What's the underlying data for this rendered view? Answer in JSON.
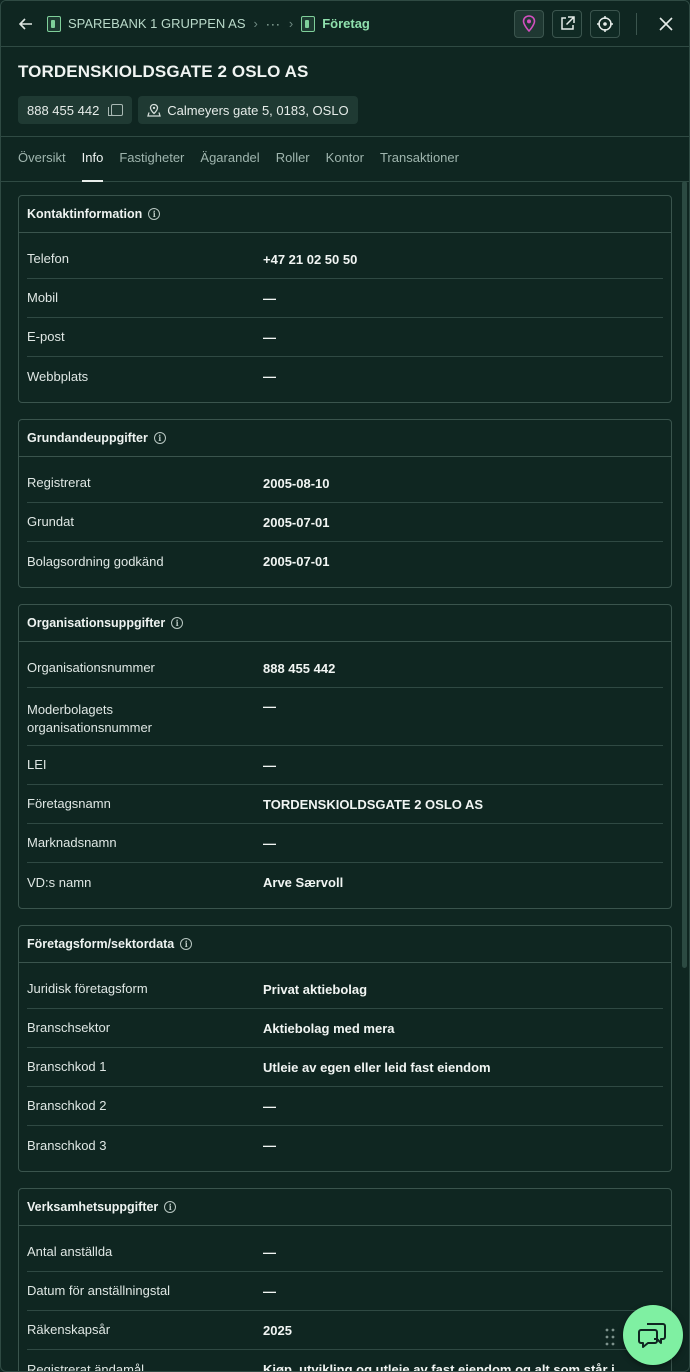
{
  "breadcrumb": {
    "root": "SPAREBANK 1 GRUPPEN AS",
    "middle": "···",
    "current": "Företag"
  },
  "company": {
    "name": "TORDENSKIOLDSGATE 2 OSLO AS",
    "org_chip": "888 455 442",
    "address_chip": "Calmeyers gate 5, 0183, OSLO"
  },
  "tabs": [
    {
      "label": "Översikt"
    },
    {
      "label": "Info"
    },
    {
      "label": "Fastigheter"
    },
    {
      "label": "Ägarandel"
    },
    {
      "label": "Roller"
    },
    {
      "label": "Kontor"
    },
    {
      "label": "Transaktioner"
    }
  ],
  "sections": {
    "contact": {
      "title": "Kontaktinformation",
      "rows": [
        {
          "k": "Telefon",
          "v": "+47 21 02 50 50"
        },
        {
          "k": "Mobil",
          "v": "—"
        },
        {
          "k": "E-post",
          "v": "—"
        },
        {
          "k": "Webbplats",
          "v": "—"
        }
      ]
    },
    "base": {
      "title": "Grundandeuppgifter",
      "rows": [
        {
          "k": "Registrerat",
          "v": "2005-08-10"
        },
        {
          "k": "Grundat",
          "v": "2005-07-01"
        },
        {
          "k": "Bolagsordning godkänd",
          "v": "2005-07-01"
        }
      ]
    },
    "org": {
      "title": "Organisationsuppgifter",
      "rows": [
        {
          "k": "Organisationsnummer",
          "v": "888 455 442"
        },
        {
          "k": "Moderbolagets organisationsnummer",
          "v": "—"
        },
        {
          "k": "LEI",
          "v": "—"
        },
        {
          "k": "Företagsnamn",
          "v": "TORDENSKIOLDSGATE 2 OSLO AS"
        },
        {
          "k": "Marknadsnamn",
          "v": "—"
        },
        {
          "k": "VD:s namn",
          "v": "Arve Særvoll"
        }
      ]
    },
    "form": {
      "title": "Företagsform/sektordata",
      "rows": [
        {
          "k": "Juridisk företagsform",
          "v": "Privat aktiebolag"
        },
        {
          "k": "Branschsektor",
          "v": "Aktiebolag med mera"
        },
        {
          "k": "Branschkod 1",
          "v": "Utleie av egen eller leid fast eiendom"
        },
        {
          "k": "Branschkod 2",
          "v": "—"
        },
        {
          "k": "Branschkod 3",
          "v": "—"
        }
      ]
    },
    "business": {
      "title": "Verksamhetsuppgifter",
      "rows": [
        {
          "k": "Antal anställda",
          "v": "—"
        },
        {
          "k": "Datum för anställningstal",
          "v": "—"
        },
        {
          "k": "Räkenskapsår",
          "v": "2025"
        },
        {
          "k": "Registrerat ändamål",
          "v": "Kjøp, utvikling og utleie av fast eiendom og alt som står i"
        }
      ]
    }
  },
  "colors": {
    "background": "#0f2621",
    "accent_green": "#7ff0a2",
    "breadcrumb_current": "#8fe0ad",
    "map_pin_accent": "#d24fbf"
  }
}
